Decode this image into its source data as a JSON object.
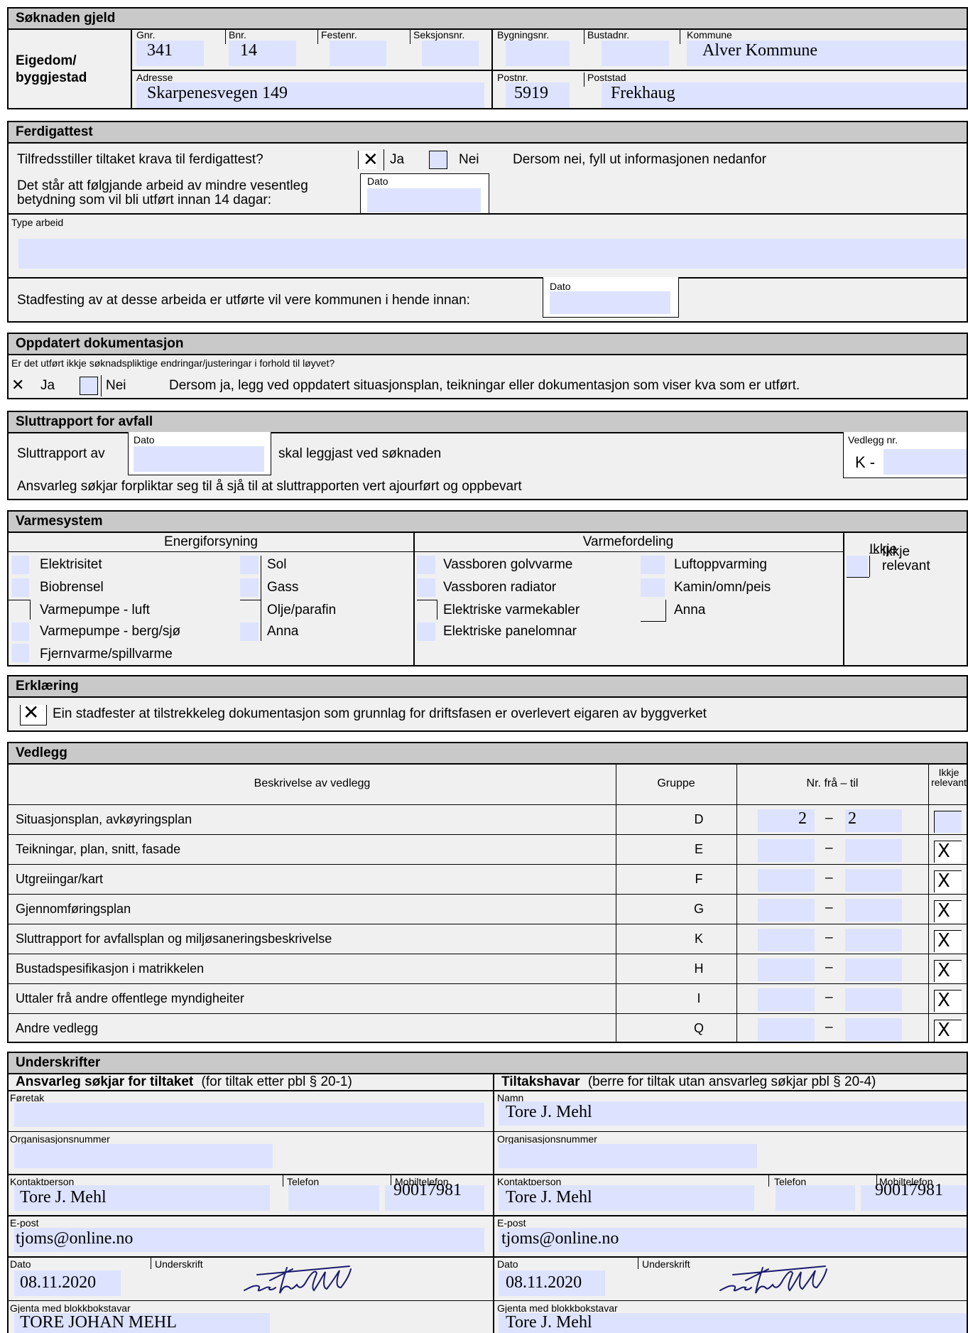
{
  "soknaden": {
    "title": "Søknaden gjeld",
    "eigedom_label_1": "Eigedom/",
    "eigedom_label_2": "byggjestad",
    "gnr_label": "Gnr.",
    "gnr": "341",
    "bnr_label": "Bnr.",
    "bnr": "14",
    "festenr_label": "Festenr.",
    "seksjonsnr_label": "Seksjonsnr.",
    "bygningsnr_label": "Bygningsnr.",
    "bustadnr_label": "Bustadnr.",
    "kommune_label": "Kommune",
    "kommune": "Alver Kommune",
    "adresse_label": "Adresse",
    "adresse": "Skarpenesvegen 149",
    "postnr_label": "Postnr.",
    "postnr": "5919",
    "poststad_label": "Poststad",
    "poststad": "Frekhaug"
  },
  "ferdigattest": {
    "title": "Ferdigattest",
    "question": "Tilfredsstiller tiltaket krava til ferdigattest?",
    "ja_label": "Ja",
    "nei_label": "Nei",
    "ja_checked": true,
    "nei_note": "Dersom nei, fyll ut informasjonen nedanfor",
    "arbeid_1": "Det står att følgjande arbeid av mindre vesentleg",
    "arbeid_2": "betydning som vil bli utført innan 14 dagar:",
    "dato_label": "Dato",
    "type_label": "Type arbeid",
    "stadfesting": "Stadfesting av at desse arbeida er utførte vil vere kommunen i hende innan:",
    "dato2_label": "Dato"
  },
  "oppdatert": {
    "title": "Oppdatert dokumentasjon",
    "question": "Er det utført ikkje søknadspliktige endringar/justeringar i forhold til løyvet?",
    "ja_label": "Ja",
    "nei_label": "Nei",
    "note": "Dersom ja, legg ved oppdatert situasjonsplan, teikningar eller dokumentasjon som viser kva som er utført."
  },
  "sluttrapport": {
    "title": "Sluttrapport for avfall",
    "label": "Sluttrapport av",
    "dato_label": "Dato",
    "after": "skal leggjast ved søknaden",
    "vedlegg_label": "Vedlegg nr.",
    "vedlegg_prefix": "K -",
    "ansvar": "Ansvarleg søkjar forpliktar seg til å sjå til at sluttrapporten vert ajourført og oppbevart"
  },
  "varmesystem": {
    "title": "Varmesystem",
    "energi_header": "Energiforsyning",
    "fordeling_header": "Varmefordeling",
    "energi_col1": [
      "Elektrisitet",
      "Biobrensel",
      "Varmepumpe - luft",
      "Varmepumpe - berg/sjø",
      "Fjernvarme/spillvarme"
    ],
    "energi_col2": [
      "Sol",
      "Gass",
      "Olje/parafin",
      "Anna"
    ],
    "fordeling_col1": [
      "Vassboren golvvarme",
      "Vassboren radiator",
      "Elektriske varmekabler",
      "Elektriske panelomnar"
    ],
    "fordeling_col2": [
      "Luftoppvarming",
      "Kamin/omn/peis",
      "Anna"
    ],
    "ikkje_1": "Ikkje",
    "ikkje_2": "relevant"
  },
  "erklaering": {
    "title": "Erklæring",
    "text": "Ein stadfester at tilstrekkeleg dokumentasjon som grunnlag for driftsfasen er overlevert eigaren av byggverket"
  },
  "vedlegg": {
    "title": "Vedlegg",
    "col_desc": "Beskrivelse av vedlegg",
    "col_gruppe": "Gruppe",
    "col_nr": "Nr. frå – til",
    "col_ikkje_1": "Ikkje",
    "col_ikkje_2": "relevant",
    "rows": [
      {
        "desc": "Situasjonsplan, avkøyringsplan",
        "gruppe": "D",
        "fra": "2",
        "til": "2",
        "ikkje": ""
      },
      {
        "desc": "Teikningar, plan, snitt, fasade",
        "gruppe": "E",
        "fra": "",
        "til": "",
        "ikkje": "X"
      },
      {
        "desc": "Utgreiingar/kart",
        "gruppe": "F",
        "fra": "",
        "til": "",
        "ikkje": "X"
      },
      {
        "desc": "Gjennomføringsplan",
        "gruppe": "G",
        "fra": "",
        "til": "",
        "ikkje": "X"
      },
      {
        "desc": "Sluttrapport for avfallsplan og miljøsaneringsbeskrivelse",
        "gruppe": "K",
        "fra": "",
        "til": "",
        "ikkje": "X"
      },
      {
        "desc": "Bustadspesifikasjon i matrikkelen",
        "gruppe": "H",
        "fra": "",
        "til": "",
        "ikkje": "X"
      },
      {
        "desc": "Uttaler frå andre offentlege myndigheiter",
        "gruppe": "I",
        "fra": "",
        "til": "",
        "ikkje": "X"
      },
      {
        "desc": "Andre vedlegg",
        "gruppe": "Q",
        "fra": "",
        "til": "",
        "ikkje": "X"
      }
    ]
  },
  "underskrifter": {
    "title": "Underskrifter",
    "left_head": "Ansvarleg søkjar for tiltaket",
    "left_sub": "(for tiltak etter pbl § 20-1)",
    "right_head": "Tiltakshavar",
    "right_sub": "(berre for tiltak utan ansvarleg søkjar pbl § 20-4)",
    "foretak_label": "Føretak",
    "namn_label": "Namn",
    "namn": "Tore J. Mehl",
    "org_label": "Organisasjonsnummer",
    "kontakt_label": "Kontaktperson",
    "telefon_label": "Telefon",
    "mobil_label": "Mobiltelefon",
    "left_kontakt": "Tore J. Mehl",
    "left_mobil": "90017981",
    "right_kontakt": "Tore J. Mehl",
    "right_mobil": "90017981",
    "epost_label": "E-post",
    "left_epost": "tjoms@online.no",
    "right_epost": "tjoms@online.no",
    "dato_label": "Dato",
    "underskrift_label": "Underskrift",
    "left_dato": "08.11.2020",
    "right_dato": "08.11.2020",
    "gjenta_label": "Gjenta med blokkbokstavar",
    "left_gjenta": "TORE JOHAN MEHL",
    "right_gjenta": "Tore J. Mehl",
    "signature_text": "Tore J. Mehl"
  }
}
